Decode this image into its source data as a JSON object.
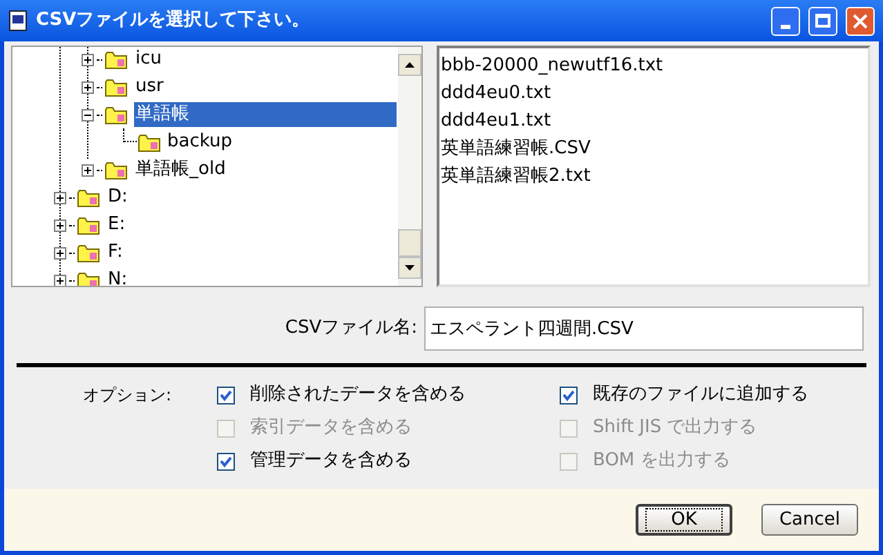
{
  "window": {
    "title": "CSVファイルを選択して下さい。"
  },
  "tree": {
    "folders": [
      {
        "label": "icu",
        "expanded": false,
        "selected": false
      },
      {
        "label": "usr",
        "expanded": false,
        "selected": false
      },
      {
        "label": "単語帳",
        "expanded": true,
        "selected": true,
        "children": [
          {
            "label": "backup"
          }
        ]
      },
      {
        "label": "単語帳_old",
        "expanded": false,
        "selected": false
      }
    ],
    "drives": [
      {
        "label": "D:",
        "expanded": false
      },
      {
        "label": "E:",
        "expanded": false
      },
      {
        "label": "F:",
        "expanded": false
      },
      {
        "label": "N:",
        "expanded": false
      }
    ]
  },
  "files": [
    "bbb-20000_newutf16.txt",
    "ddd4eu0.txt",
    "ddd4eu1.txt",
    "英単語練習帳.CSV",
    "英単語練習帳2.txt"
  ],
  "filename": {
    "label": "CSVファイル名:",
    "value": "エスペラント四週間.CSV"
  },
  "options": {
    "label": "オプション:",
    "columns": [
      [
        {
          "label": "削除されたデータを含める",
          "checked": true,
          "disabled": false
        },
        {
          "label": "索引データを含める",
          "checked": false,
          "disabled": true
        },
        {
          "label": "管理データを含める",
          "checked": true,
          "disabled": false
        }
      ],
      [
        {
          "label": "既存のファイルに追加する",
          "checked": true,
          "disabled": false
        },
        {
          "label": "Shift JIS で出力する",
          "checked": false,
          "disabled": true
        },
        {
          "label": "BOM を出力する",
          "checked": false,
          "disabled": true
        }
      ]
    ]
  },
  "buttons": [
    {
      "label": "OK",
      "default": true
    },
    {
      "label": "Cancel",
      "default": false
    }
  ]
}
